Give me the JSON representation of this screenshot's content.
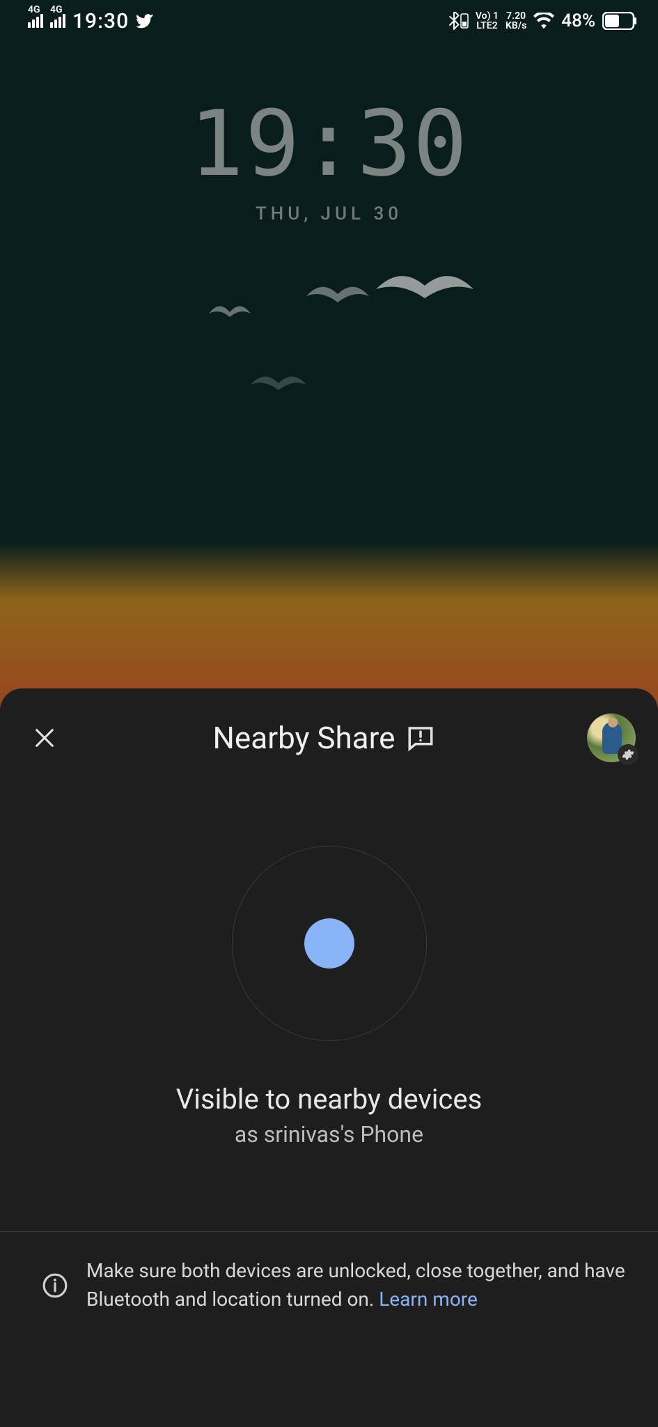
{
  "status_bar": {
    "signal_label": "4G",
    "clock": "19:30",
    "net_top": "Vo) 1",
    "net_bottom": "LTE2",
    "speed_top": "7.20",
    "speed_bottom": "KB/s",
    "battery_pct": "48%"
  },
  "lock": {
    "time": "19:30",
    "date": "THU, JUL 30"
  },
  "sheet": {
    "title": "Nearby Share",
    "visibility_title": "Visible to nearby devices",
    "visibility_subtitle": "as srinivas's Phone",
    "info_text": "Make sure both devices are unlocked, close together, and have Bluetooth and location turned on. ",
    "learn_more": "Learn more"
  }
}
